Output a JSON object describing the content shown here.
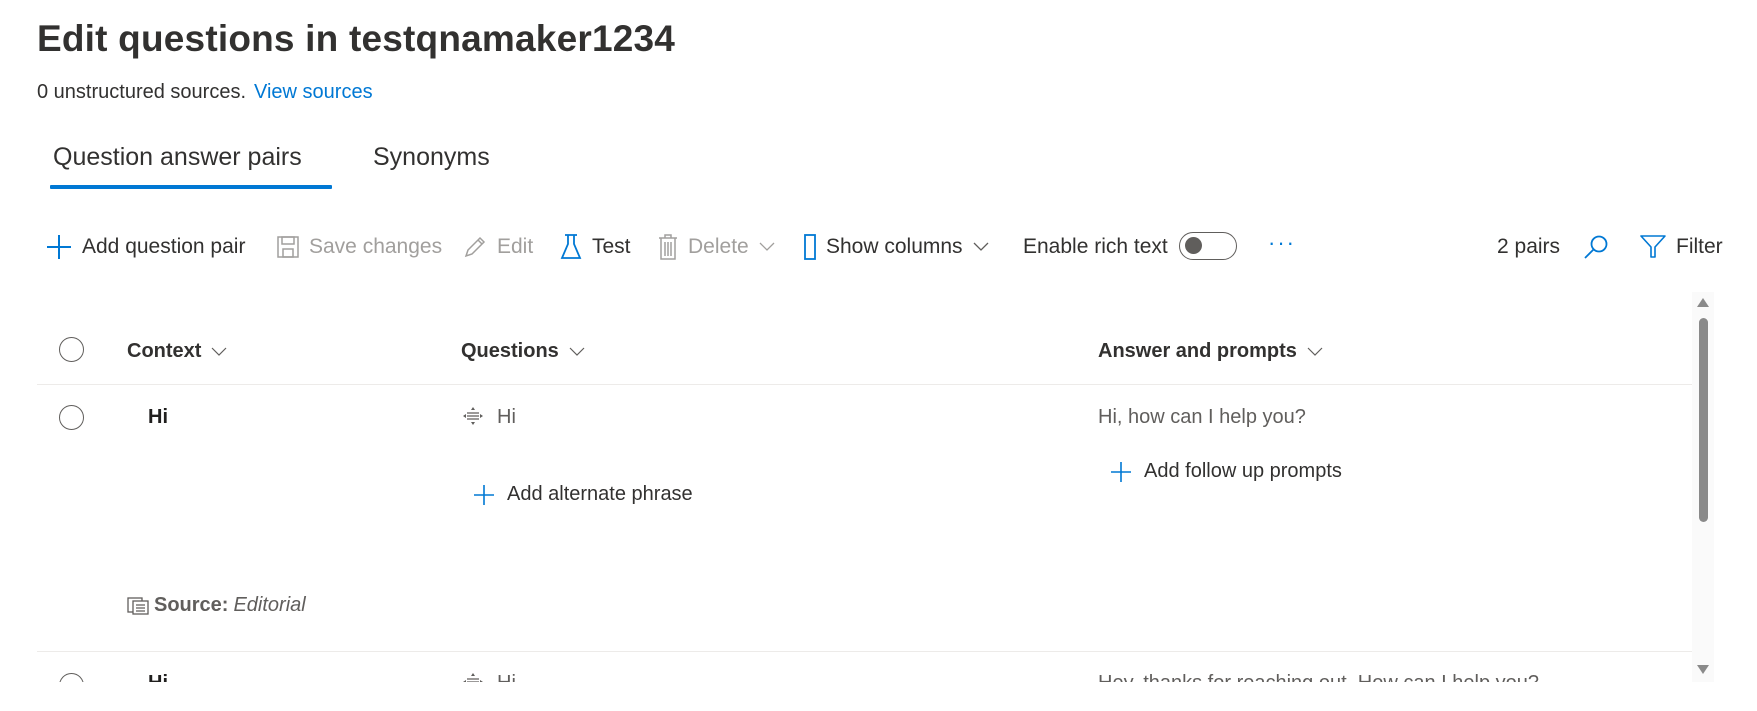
{
  "page": {
    "title": "Edit questions in testqnamaker1234",
    "sources_text": "0 unstructured sources.",
    "view_sources_link": "View sources"
  },
  "tabs": [
    {
      "label": "Question answer pairs",
      "active": true
    },
    {
      "label": "Synonyms",
      "active": false
    }
  ],
  "toolbar": {
    "add_question_pair": "Add question pair",
    "save_changes": "Save changes",
    "edit": "Edit",
    "test": "Test",
    "delete": "Delete",
    "show_columns": "Show columns",
    "enable_rich_text": "Enable rich text",
    "rich_text_enabled": false,
    "more": "···",
    "pair_count": "2 pairs",
    "filter": "Filter"
  },
  "colors": {
    "accent": "#0078d4",
    "text": "#323130",
    "disabled": "#a19f9d"
  },
  "table": {
    "columns": [
      {
        "label": "Context"
      },
      {
        "label": "Questions"
      },
      {
        "label": "Answer and prompts"
      }
    ],
    "rows": [
      {
        "context": "Hi",
        "question": "Hi",
        "add_alternate": "Add alternate phrase",
        "answer": "Hi, how can I help you?",
        "add_follow_up": "Add follow up prompts",
        "source_label": "Source:",
        "source_value": "Editorial"
      },
      {
        "context": "Hi",
        "question": "Hi",
        "answer": "Hey, thanks for reaching out. How can I help you?"
      }
    ]
  }
}
